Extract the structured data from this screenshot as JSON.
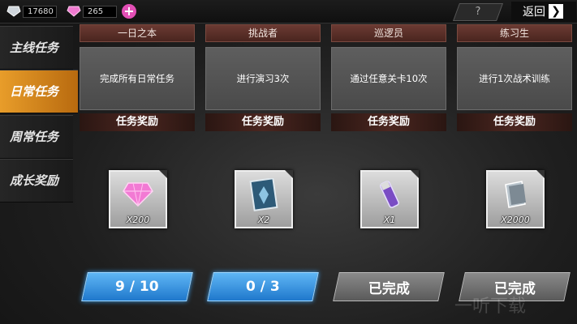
{
  "resources": {
    "crystal_amount": "17680",
    "gem_amount": "265",
    "add_symbol": "+"
  },
  "header": {
    "help_label": "?",
    "back_label": "返回",
    "back_chevron": "❯"
  },
  "sidebar": {
    "items": [
      {
        "label": "主线任务",
        "active": false
      },
      {
        "label": "日常任务",
        "active": true
      },
      {
        "label": "周常任务",
        "active": false
      },
      {
        "label": "成长奖励",
        "active": false
      }
    ]
  },
  "cards": [
    {
      "title": "一日之本",
      "task": "完成所有日常任务",
      "reward_title": "任务奖励",
      "reward_icon": "pink-gem-icon",
      "quantity": "X200",
      "button": "9 / 10",
      "state": "progress"
    },
    {
      "title": "挑战者",
      "task": "进行演习3次",
      "reward_title": "任务奖励",
      "reward_icon": "blueprint-card-icon",
      "quantity": "X2",
      "button": "0 / 3",
      "state": "progress"
    },
    {
      "title": "巡逻员",
      "task": "通过任意关卡10次",
      "reward_title": "任务奖励",
      "reward_icon": "purple-vial-icon",
      "quantity": "X1",
      "button": "已完成",
      "state": "done"
    },
    {
      "title": "练习生",
      "task": "进行1次战术训练",
      "reward_title": "任务奖励",
      "reward_icon": "manual-book-icon",
      "quantity": "X2000",
      "button": "已完成",
      "state": "done"
    }
  ],
  "watermark": "一听下载",
  "colors": {
    "active_tab": "#e89d2a",
    "progress_button": "#3a9ae6",
    "done_button": "#6e6e6e",
    "card_header": "#5a2e27"
  }
}
